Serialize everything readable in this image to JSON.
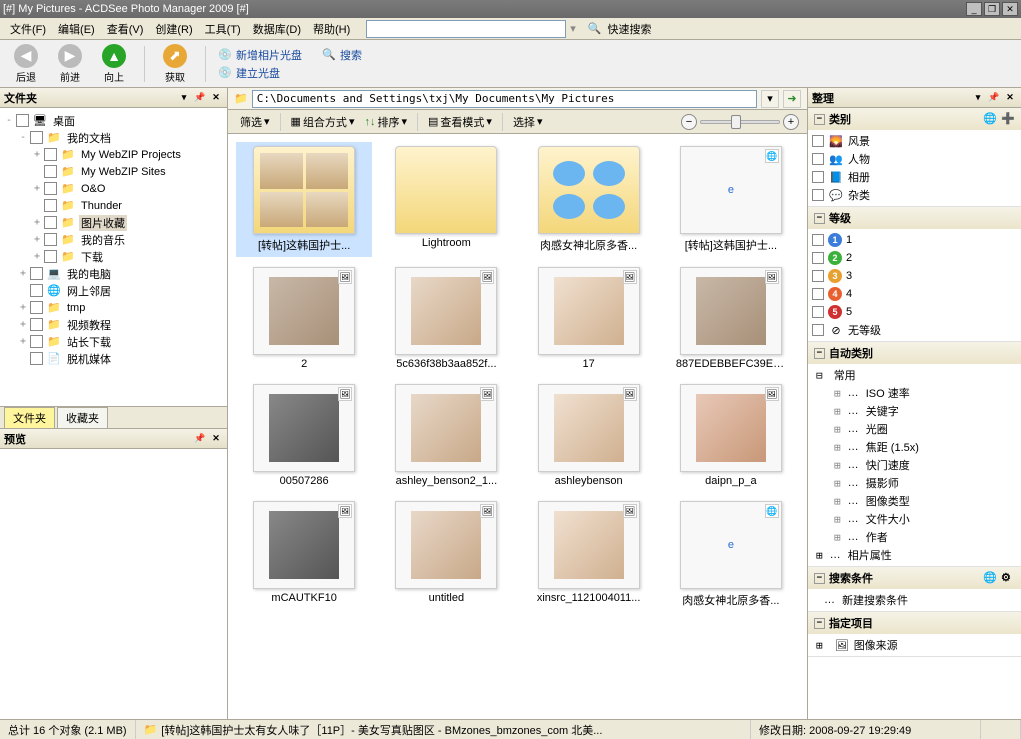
{
  "window": {
    "title": "[#] My Pictures - ACDSee Photo Manager 2009 [#]"
  },
  "menu": {
    "items": [
      "文件(F)",
      "编辑(E)",
      "查看(V)",
      "创建(R)",
      "工具(T)",
      "数据库(D)",
      "帮助(H)"
    ],
    "quicksearch_label": "快速搜索"
  },
  "toolbar": {
    "back": "后退",
    "forward": "前进",
    "up": "向上",
    "get": "获取",
    "links": [
      "新增相片光盘",
      "建立光盘",
      "搜索"
    ]
  },
  "panels": {
    "folders_title": "文件夹",
    "preview_title": "预览",
    "organize_title": "整理",
    "tabs": [
      "文件夹",
      "收藏夹"
    ]
  },
  "tree": [
    {
      "lvl": 0,
      "exp": "-",
      "icon": "🖥",
      "label": "桌面"
    },
    {
      "lvl": 1,
      "exp": "-",
      "icon": "📁",
      "label": "我的文档"
    },
    {
      "lvl": 2,
      "exp": "+",
      "icon": "📁",
      "label": "My WebZIP Projects"
    },
    {
      "lvl": 2,
      "exp": "",
      "icon": "📁",
      "label": "My WebZIP Sites"
    },
    {
      "lvl": 2,
      "exp": "+",
      "icon": "📁",
      "label": "O&O"
    },
    {
      "lvl": 2,
      "exp": "",
      "icon": "📁",
      "label": "Thunder"
    },
    {
      "lvl": 2,
      "exp": "+",
      "icon": "📁",
      "label": "图片收藏",
      "sel": true
    },
    {
      "lvl": 2,
      "exp": "+",
      "icon": "📁",
      "label": "我的音乐"
    },
    {
      "lvl": 2,
      "exp": "+",
      "icon": "📁",
      "label": "下载"
    },
    {
      "lvl": 1,
      "exp": "+",
      "icon": "💻",
      "label": "我的电脑"
    },
    {
      "lvl": 1,
      "exp": "",
      "icon": "🌐",
      "label": "网上邻居"
    },
    {
      "lvl": 1,
      "exp": "+",
      "icon": "📁",
      "label": "tmp"
    },
    {
      "lvl": 1,
      "exp": "+",
      "icon": "📁",
      "label": "视频教程"
    },
    {
      "lvl": 1,
      "exp": "+",
      "icon": "📁",
      "label": "站长下载"
    },
    {
      "lvl": 1,
      "exp": "",
      "icon": "📄",
      "label": "脱机媒体"
    }
  ],
  "address": {
    "path": "C:\\Documents and Settings\\txj\\My Documents\\My Pictures"
  },
  "viewbar": {
    "filter": "筛选",
    "group": "组合方式",
    "sort": "排序",
    "viewmode": "查看模式",
    "select": "选择"
  },
  "items": [
    {
      "name": "[转帖]这韩国护士...",
      "kind": "folder-thumbs"
    },
    {
      "name": "Lightroom",
      "kind": "folder"
    },
    {
      "name": "肉感女神北原多香...",
      "kind": "folder-icons"
    },
    {
      "name": "[转帖]这韩国护士...",
      "kind": "ie"
    },
    {
      "name": "2",
      "kind": "img",
      "v": "p2"
    },
    {
      "name": "5c636f38b3aa852f...",
      "kind": "img",
      "v": "p3"
    },
    {
      "name": "17",
      "kind": "img",
      "v": "p4"
    },
    {
      "name": "887EDEBBEFC39EB3...",
      "kind": "img",
      "v": "p2"
    },
    {
      "name": "00507286",
      "kind": "img",
      "v": "p5"
    },
    {
      "name": "ashley_benson2_1...",
      "kind": "img",
      "v": "p3"
    },
    {
      "name": "ashleybenson",
      "kind": "img",
      "v": "p4"
    },
    {
      "name": "daipn_p_a",
      "kind": "img",
      "v": "p6"
    },
    {
      "name": "mCAUTKF10",
      "kind": "img",
      "v": "p5"
    },
    {
      "name": "untitled",
      "kind": "img",
      "v": "p3"
    },
    {
      "name": "xinsrc_1121004011...",
      "kind": "img",
      "v": "p4"
    },
    {
      "name": "肉感女神北原多香...",
      "kind": "ie"
    }
  ],
  "organize": {
    "categories": {
      "title": "类别",
      "items": [
        "风景",
        "人物",
        "相册",
        "杂类"
      ]
    },
    "ratings": {
      "title": "等级",
      "items": [
        "1",
        "2",
        "3",
        "4",
        "5"
      ],
      "none": "无等级"
    },
    "autocat": {
      "title": "自动类别",
      "common": "常用",
      "items": [
        "ISO 速率",
        "关键字",
        "光圈",
        "焦距 (1.5x)",
        "快门速度",
        "摄影师",
        "图像类型",
        "文件大小",
        "作者"
      ],
      "photoattr": "相片属性"
    },
    "search": {
      "title": "搜索条件",
      "new": "新建搜索条件"
    },
    "special": {
      "title": "指定项目",
      "src": "图像来源"
    }
  },
  "status": {
    "total": "总计 16 个对象 (2.1 MB)",
    "sel": "[转帖]这韩国护士太有女人味了［11P］- 美女写真贴图区 - BMzones_bmzones_com 北美...",
    "mod": "修改日期: 2008-09-27 19:29:49"
  }
}
